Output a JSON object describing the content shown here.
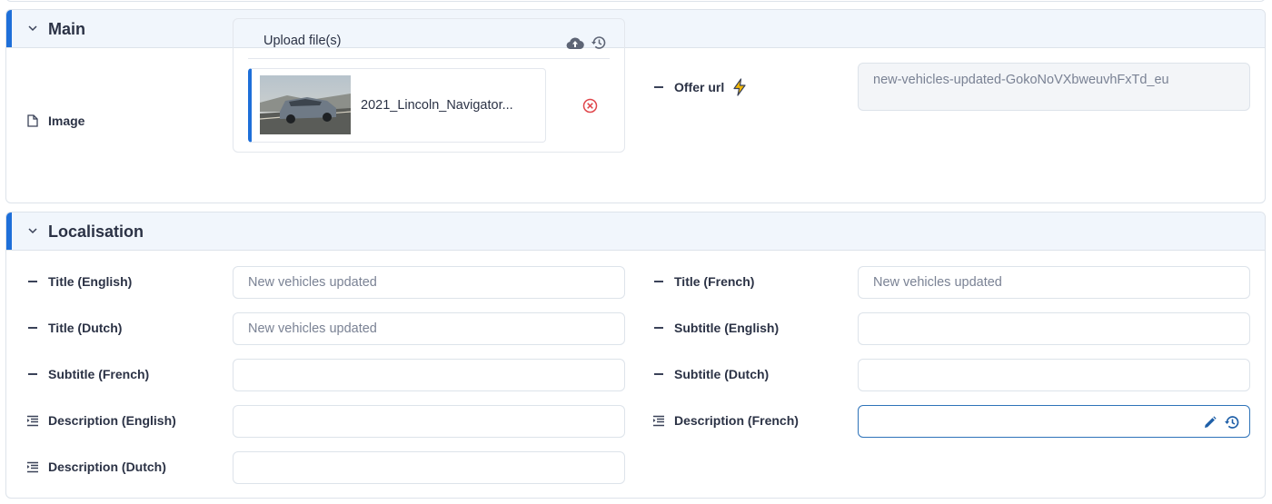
{
  "main": {
    "title": "Main",
    "image_label": "Image",
    "upload_label": "Upload file(s)",
    "file_name": "2021_Lincoln_Navigator...",
    "offer_url_label": "Offer url",
    "offer_url_value": "new-vehicles-updated-GokoNoVXbweuvhFxTd_eu"
  },
  "localisation": {
    "title": "Localisation",
    "fields": [
      {
        "label": "Title (English)",
        "value": "New vehicles updated"
      },
      {
        "label": "Title (French)",
        "value": "New vehicles updated"
      },
      {
        "label": "Title (Dutch)",
        "value": "New vehicles updated"
      },
      {
        "label": "Subtitle (English)",
        "value": ""
      },
      {
        "label": "Subtitle (French)",
        "value": ""
      },
      {
        "label": "Subtitle (Dutch)",
        "value": ""
      },
      {
        "label": "Description (English)",
        "value": ""
      },
      {
        "label": "Description (French)",
        "value": ""
      },
      {
        "label": "Description (Dutch)",
        "value": ""
      }
    ]
  },
  "colors": {
    "accent": "#1e6fd9",
    "header_bg": "#f1f6fc",
    "remove": "#e0464b",
    "bolt": "#f2b705",
    "active_border": "#2e73b9"
  },
  "icons": [
    "chevron-down-icon",
    "file-icon",
    "dash-icon",
    "bolt-icon",
    "cloud-upload-icon",
    "history-icon",
    "remove-circle-icon",
    "text-indent-icon",
    "pencil-icon"
  ]
}
